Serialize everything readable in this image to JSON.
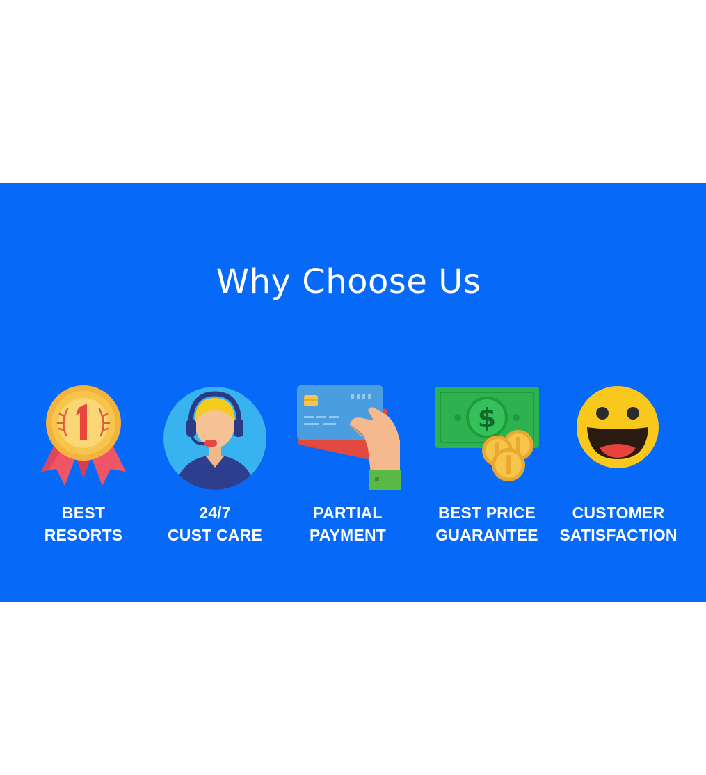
{
  "section": {
    "title": "Why Choose Us"
  },
  "features": [
    {
      "icon": "gold-medal-number-one-icon",
      "line1": "BEST",
      "line2": "RESORTS"
    },
    {
      "icon": "customer-support-headset-icon",
      "line1": "24/7",
      "line2": "CUST CARE"
    },
    {
      "icon": "credit-card-payment-icon",
      "line1": "PARTIAL",
      "line2": "PAYMENT"
    },
    {
      "icon": "money-banknote-coins-icon",
      "line1": "BEST PRICE",
      "line2": "GUARANTEE"
    },
    {
      "icon": "smiley-face-icon",
      "line1": "CUSTOMER",
      "line2": "SATISFACTION"
    }
  ],
  "colors": {
    "banner_background": "#0769f8",
    "text": "#ffffff",
    "medal_gold": "#f7c44c",
    "ribbon_red": "#f05565",
    "banknote_green": "#2eb24f",
    "smiley_yellow": "#f8c81c"
  }
}
